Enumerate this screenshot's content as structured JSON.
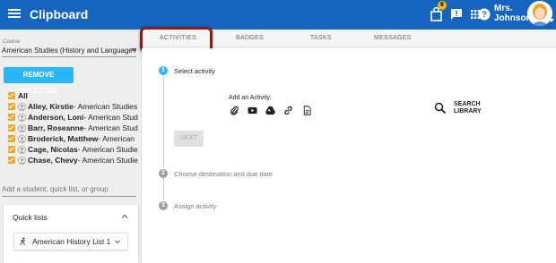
{
  "topbar": {
    "brand": "Clipboard",
    "notification_count": "6",
    "user_name_line1": "Mrs.",
    "user_name_line2": "Johnson"
  },
  "sidebar": {
    "course_label": "Course",
    "course_value": "American Studies (History and Language Ar...",
    "remove_button": "REMOVE SELECTED",
    "all_label": "All",
    "students": [
      {
        "name": "Alley, Kirstie",
        "course": " - American Studies"
      },
      {
        "name": "Anderson, Loni",
        "course": " - American Stud"
      },
      {
        "name": "Barr, Roseanne",
        "course": " - American Stud"
      },
      {
        "name": "Broderick, Matthew",
        "course": " - American"
      },
      {
        "name": "Cage, Nicolas",
        "course": " - American Studie"
      },
      {
        "name": "Chase, Chevy",
        "course": " - American Studie"
      }
    ],
    "add_placeholder": "Add a student, quick list, or group",
    "quick_lists_title": "Quick lists",
    "quick_list_item": "American History List 1"
  },
  "tabs": [
    "ACTIVITIES",
    "BADGES",
    "TASKS",
    "MESSAGES"
  ],
  "steps": [
    {
      "num": "1",
      "label": "Select activity"
    },
    {
      "num": "2",
      "label": "Choose destination and due date"
    },
    {
      "num": "3",
      "label": "Assign activity"
    }
  ],
  "activity": {
    "add_label": "Add an Activity:",
    "search_line1": "SEARCH",
    "search_line2": "LIBRARY",
    "next_button": "NEXT",
    "icons": [
      "paperclip-icon",
      "youtube-icon",
      "google-drive-icon",
      "link-icon",
      "document-icon"
    ]
  },
  "colors": {
    "topbar": "#1565c0",
    "accent": "#29b6f6",
    "checkbox": "#f5a623",
    "highlight": "#8b1a1a"
  }
}
